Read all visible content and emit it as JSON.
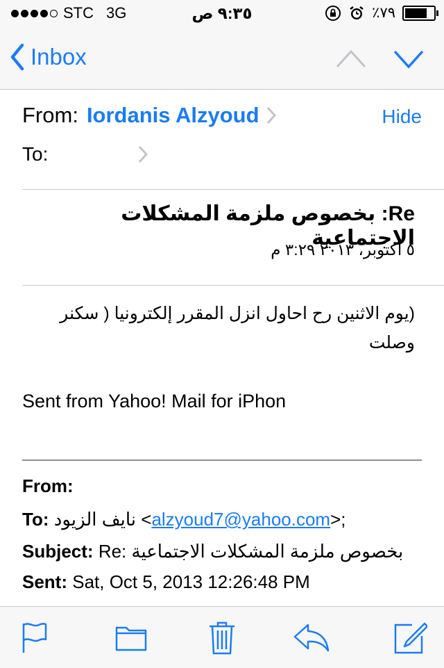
{
  "status_bar": {
    "carrier": "STC",
    "network": "3G",
    "time": "٩:٣٥ ص",
    "battery": "٪٧٩"
  },
  "nav": {
    "back_label": "Inbox"
  },
  "header": {
    "from_label": "From:",
    "from_name": "Iordanis Alzyoud",
    "hide_label": "Hide",
    "to_label": "To:"
  },
  "message": {
    "subject": "Re: بخصوص ملزمة المشكلات الاجتماعية",
    "date": "٥ أكتوبر، ٢٠١٣ ٣:٢٩ م",
    "body_arabic": "(يوم الاثنين رح احاول انزل المقرر إلكترونيا ( سكنر وصلت",
    "signature": "Sent from Yahoo! Mail for iPhon"
  },
  "quoted": {
    "from_label": "From:",
    "to_label": "To:",
    "to_name": "نايف الزيود",
    "to_email": "alzyoud7@yahoo.com",
    "to_open": " <",
    "to_close": ">;",
    "subject_label": "Subject:",
    "subject_value": "Re: بخصوص ملزمة المشكلات الاجتماعية",
    "sent_label": "Sent:",
    "sent_value": "Sat, Oct 5, 2013 12:26:48 PM"
  },
  "colors": {
    "accent": "#1a7cf5",
    "bar_bg": "#f7f7f7",
    "separator": "#c8c8cc"
  },
  "toolbar": {
    "icons": [
      "flag-icon",
      "folder-icon",
      "trash-icon",
      "reply-icon",
      "compose-icon"
    ]
  }
}
